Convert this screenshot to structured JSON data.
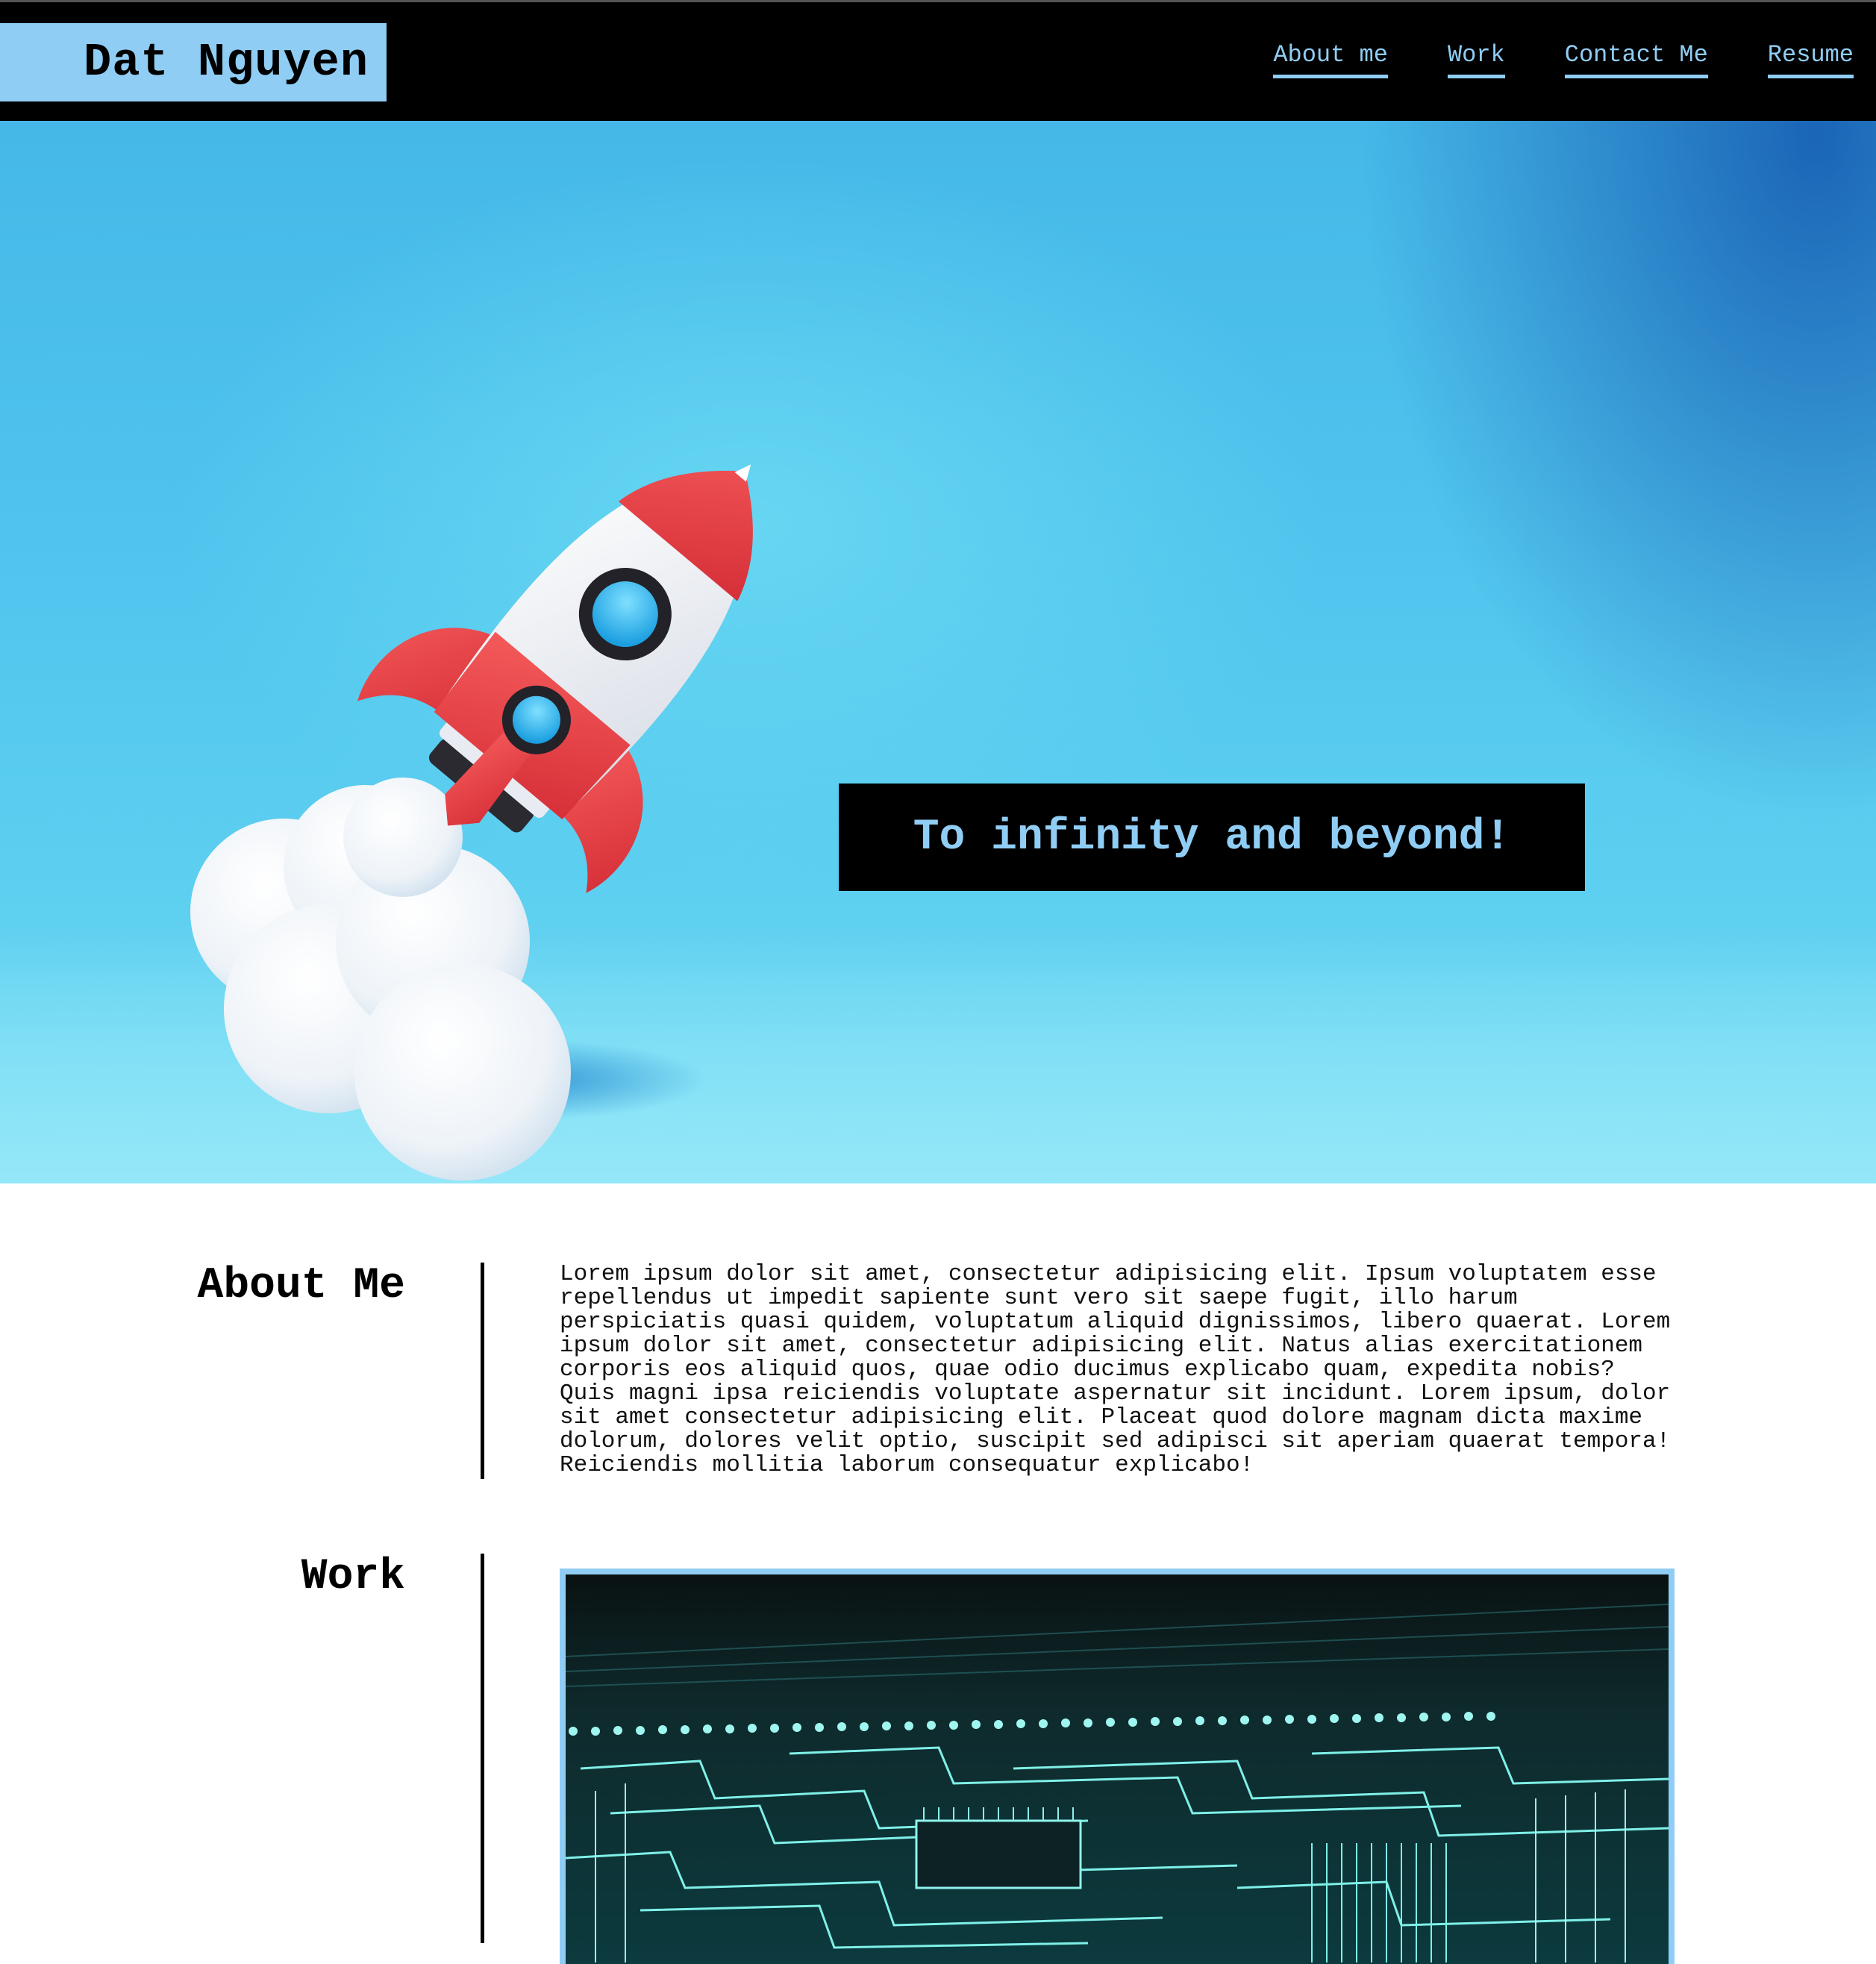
{
  "header": {
    "brand": "Dat Nguyen",
    "nav": [
      {
        "label": "About me"
      },
      {
        "label": "Work"
      },
      {
        "label": "Contact Me"
      },
      {
        "label": "Resume"
      }
    ]
  },
  "hero": {
    "tagline": "To infinity and beyond!"
  },
  "about": {
    "title": "About Me",
    "body": "Lorem ipsum dolor sit amet, consectetur adipisicing elit. Ipsum voluptatem esse repellendus ut impedit sapiente sunt vero sit saepe fugit, illo harum perspiciatis quasi quidem, voluptatum aliquid dignissimos, libero quaerat. Lorem ipsum dolor sit amet, consectetur adipisicing elit. Natus alias exercitationem corporis eos aliquid quos, quae odio ducimus explicabo quam, expedita nobis? Quis magni ipsa reiciendis voluptate aspernatur sit incidunt. Lorem ipsum, dolor sit amet consectetur adipisicing elit. Placeat quod dolore magnam dicta maxime dolorum, dolores velit optio, suscipit sed adipisci sit aperiam quaerat tempora! Reiciendis mollitia laborum consequatur explicabo!"
  },
  "work": {
    "title": "Work"
  },
  "colors": {
    "accent": "#90cdf4",
    "header_bg": "#000000",
    "hero_blue": "#52c6ee"
  }
}
